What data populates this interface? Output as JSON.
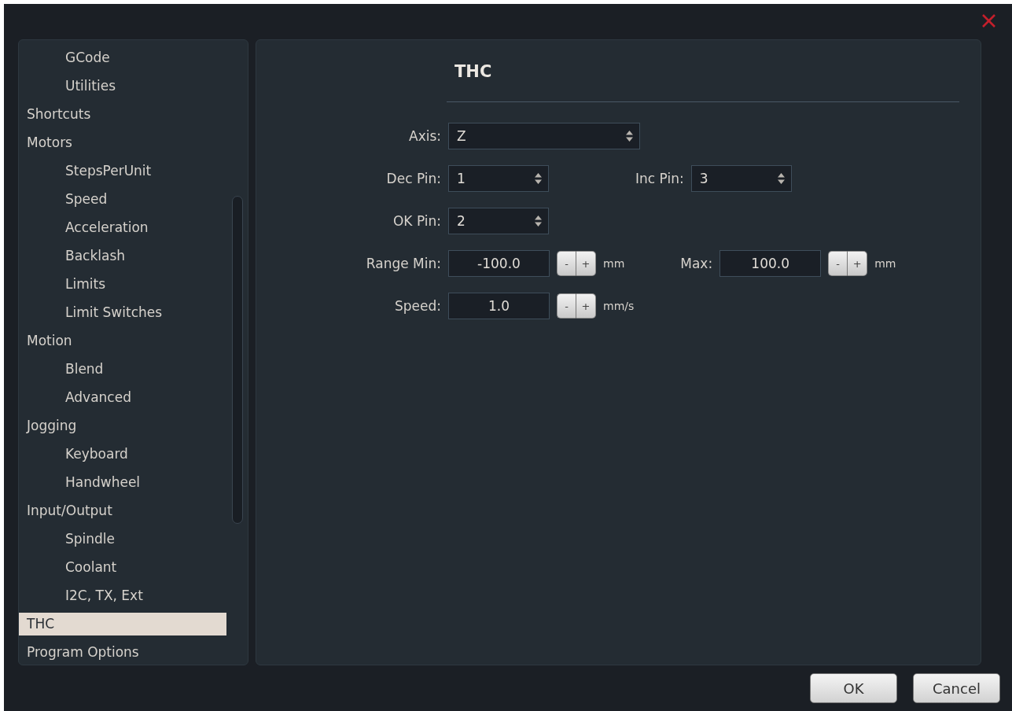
{
  "sidebar": {
    "leading_children": [
      {
        "label": "GCode",
        "selected": false
      },
      {
        "label": "Utilities",
        "selected": false
      }
    ],
    "items": [
      {
        "label": "Shortcuts",
        "selected": false
      },
      {
        "label": "Motors",
        "selected": false,
        "children": [
          {
            "label": "StepsPerUnit",
            "selected": false
          },
          {
            "label": "Speed",
            "selected": false
          },
          {
            "label": "Acceleration",
            "selected": false
          },
          {
            "label": "Backlash",
            "selected": false
          },
          {
            "label": "Limits",
            "selected": false
          },
          {
            "label": "Limit Switches",
            "selected": false
          }
        ]
      },
      {
        "label": "Motion",
        "selected": false,
        "children": [
          {
            "label": "Blend",
            "selected": false
          },
          {
            "label": "Advanced",
            "selected": false
          }
        ]
      },
      {
        "label": "Jogging",
        "selected": false,
        "children": [
          {
            "label": "Keyboard",
            "selected": false
          },
          {
            "label": "Handwheel",
            "selected": false
          }
        ]
      },
      {
        "label": "Input/Output",
        "selected": false,
        "children": [
          {
            "label": "Spindle",
            "selected": false
          },
          {
            "label": "Coolant",
            "selected": false
          },
          {
            "label": "I2C, TX, Ext",
            "selected": false
          }
        ]
      },
      {
        "label": "THC",
        "selected": true
      },
      {
        "label": "Program Options",
        "selected": false
      }
    ]
  },
  "content": {
    "title": "THC",
    "rows": [
      {
        "fields": [
          {
            "kind": "select",
            "label": "Axis:",
            "value": "Z"
          }
        ]
      },
      {
        "fields": [
          {
            "kind": "select",
            "label": "Dec Pin:",
            "value": "1"
          },
          {
            "kind": "select",
            "label": "Inc Pin:",
            "value": "3"
          }
        ]
      },
      {
        "fields": [
          {
            "kind": "select",
            "label": "OK Pin:",
            "value": "2"
          }
        ]
      },
      {
        "fields": [
          {
            "kind": "number",
            "label": "Range Min:",
            "value": "-100.0",
            "minus": "-",
            "plus": "+",
            "unit": "mm"
          },
          {
            "kind": "number",
            "label": "Max:",
            "value": "100.0",
            "minus": "-",
            "plus": "+",
            "unit": "mm"
          }
        ]
      },
      {
        "fields": [
          {
            "kind": "number",
            "label": "Speed:",
            "value": "1.0",
            "minus": "-",
            "plus": "+",
            "unit": "mm/s"
          }
        ]
      }
    ]
  },
  "buttons": [
    "OK",
    "Cancel"
  ]
}
